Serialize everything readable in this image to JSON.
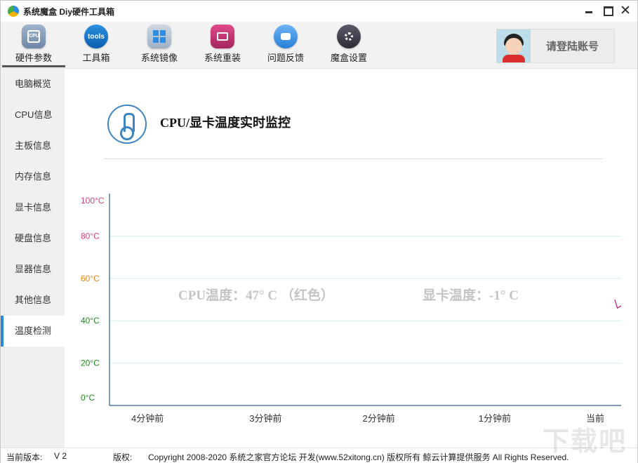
{
  "app": {
    "title": "系统魔盒 Diy硬件工具箱"
  },
  "toolbar": {
    "tools": [
      {
        "label": "硬件参数",
        "icon": "chip-icon",
        "icon_text": "CPU"
      },
      {
        "label": "工具箱",
        "icon": "tools-icon",
        "icon_text": "tools"
      },
      {
        "label": "系统镜像",
        "icon": "windows-icon"
      },
      {
        "label": "系统重装",
        "icon": "monitor-icon"
      },
      {
        "label": "问题反馈",
        "icon": "chat-icon"
      },
      {
        "label": "魔盒设置",
        "icon": "gear-icon"
      }
    ]
  },
  "login": {
    "label": "请登陆账号"
  },
  "sidebar": {
    "items": [
      {
        "label": "电脑概览"
      },
      {
        "label": "CPU信息"
      },
      {
        "label": "主板信息"
      },
      {
        "label": "内存信息"
      },
      {
        "label": "显卡信息"
      },
      {
        "label": "硬盘信息"
      },
      {
        "label": "显器信息"
      },
      {
        "label": "其他信息"
      },
      {
        "label": "温度检测"
      }
    ]
  },
  "main": {
    "title": "CPU/显卡温度实时监控"
  },
  "chart_data": {
    "type": "line",
    "y_ticks": [
      {
        "label": "100°C",
        "value": 100,
        "color": "#d0407e"
      },
      {
        "label": "80°C",
        "value": 80,
        "color": "#d0407e"
      },
      {
        "label": "60°C",
        "value": 60,
        "color": "#e08a18"
      },
      {
        "label": "40°C",
        "value": 40,
        "color": "#1e8a1e"
      },
      {
        "label": "20°C",
        "value": 20,
        "color": "#1e8a1e"
      },
      {
        "label": "0°C",
        "value": 0,
        "color": "#1e8a1e"
      }
    ],
    "x_ticks": [
      "4分钟前",
      "3分钟前",
      "2分钟前",
      "1分钟前",
      "当前"
    ],
    "ylim": [
      0,
      100
    ],
    "xlim": [
      -4,
      0
    ],
    "grid": true,
    "series": [
      {
        "color": "#c0177a",
        "x": [
          -0.05,
          -0.03,
          0
        ],
        "y": [
          50,
          46,
          47
        ]
      }
    ],
    "annotations": [
      {
        "text": "CPU温度：47° C  （红色）"
      },
      {
        "text": "显卡温度：-1° C"
      }
    ]
  },
  "statusbar": {
    "version_label": "当前版本:",
    "version_value": "V 2",
    "copyright_label": "版权:",
    "copyright_text": "Copyright 2008-2020 系统之家官方论坛 开发(www.52xitong.cn)  版权所有  鲸云计算提供服务 All Rights Reserved."
  },
  "watermark": {
    "text": "下载吧"
  }
}
